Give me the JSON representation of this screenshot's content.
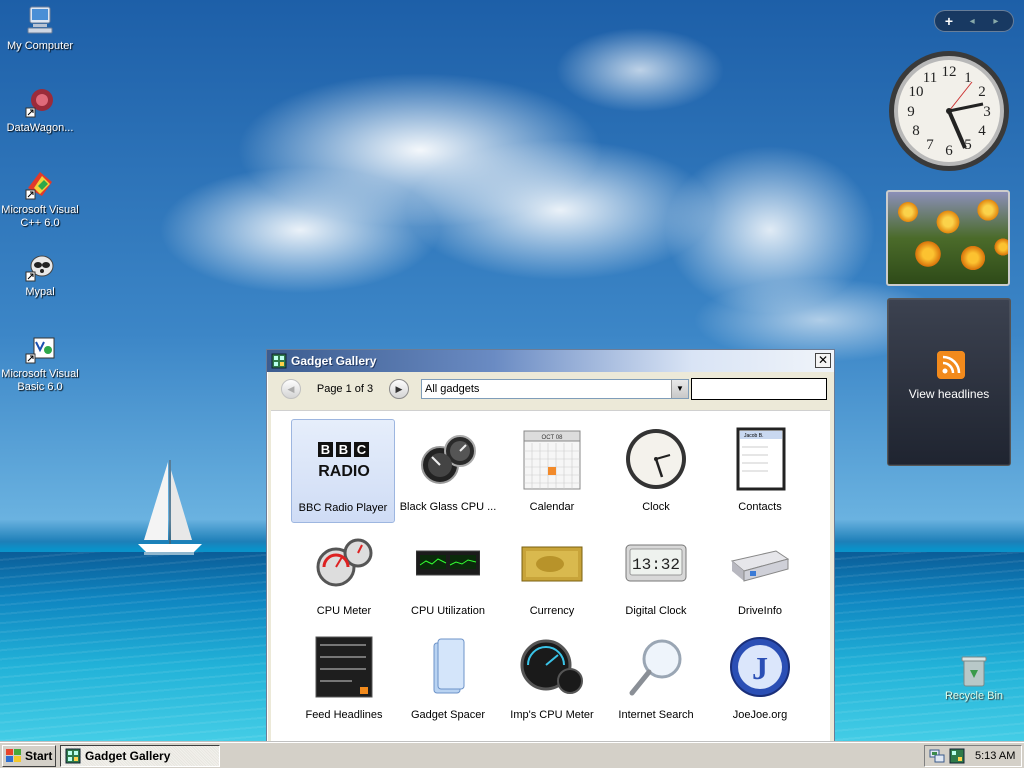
{
  "desktop": {
    "icons": [
      {
        "label": "My Computer"
      },
      {
        "label": "DataWagon..."
      },
      {
        "label": "Microsoft Visual C++ 6.0"
      },
      {
        "label": "Mypal"
      },
      {
        "label": "Microsoft Visual Basic 6.0"
      }
    ],
    "recycle_bin": "Recycle Bin"
  },
  "sidebar": {
    "add_label": "+",
    "nav_label": "◂ ▸",
    "feed_label": "View headlines"
  },
  "gallery": {
    "title": "Gadget Gallery",
    "close_label": "✕",
    "page_label": "Page 1 of 3",
    "prev_label": "◀",
    "next_label": "▶",
    "filter_value": "All gadgets",
    "filter_drop": "▼",
    "search_placeholder": "",
    "items": [
      {
        "label": "BBC Radio Player",
        "icon": "bbc-radio-icon",
        "selected": true
      },
      {
        "label": "Black Glass CPU ...",
        "icon": "black-glass-cpu-icon"
      },
      {
        "label": "Calendar",
        "icon": "calendar-icon"
      },
      {
        "label": "Clock",
        "icon": "clock-icon"
      },
      {
        "label": "Contacts",
        "icon": "contacts-icon"
      },
      {
        "label": "CPU Meter",
        "icon": "cpu-meter-icon"
      },
      {
        "label": "CPU Utilization",
        "icon": "cpu-utilization-icon"
      },
      {
        "label": "Currency",
        "icon": "currency-icon"
      },
      {
        "label": "Digital Clock",
        "icon": "digital-clock-icon"
      },
      {
        "label": "DriveInfo",
        "icon": "drive-info-icon"
      },
      {
        "label": "Feed Headlines",
        "icon": "feed-headlines-icon"
      },
      {
        "label": "Gadget Spacer",
        "icon": "gadget-spacer-icon"
      },
      {
        "label": "Imp's CPU Meter",
        "icon": "imps-cpu-meter-icon"
      },
      {
        "label": "Internet Search",
        "icon": "internet-search-icon"
      },
      {
        "label": "JoeJoe.org",
        "icon": "joejoe-icon"
      }
    ],
    "thumb_text": {
      "bbc_top": "BBC",
      "bbc_bottom": "RADIO",
      "calendar_month": "OCT 08",
      "digital_time": "13:32",
      "contacts_top": "Jacob B.",
      "joejoe_letter": "J"
    }
  },
  "taskbar": {
    "start_label": "Start",
    "task_label": "Gadget Gallery",
    "time": "5:13 AM"
  }
}
